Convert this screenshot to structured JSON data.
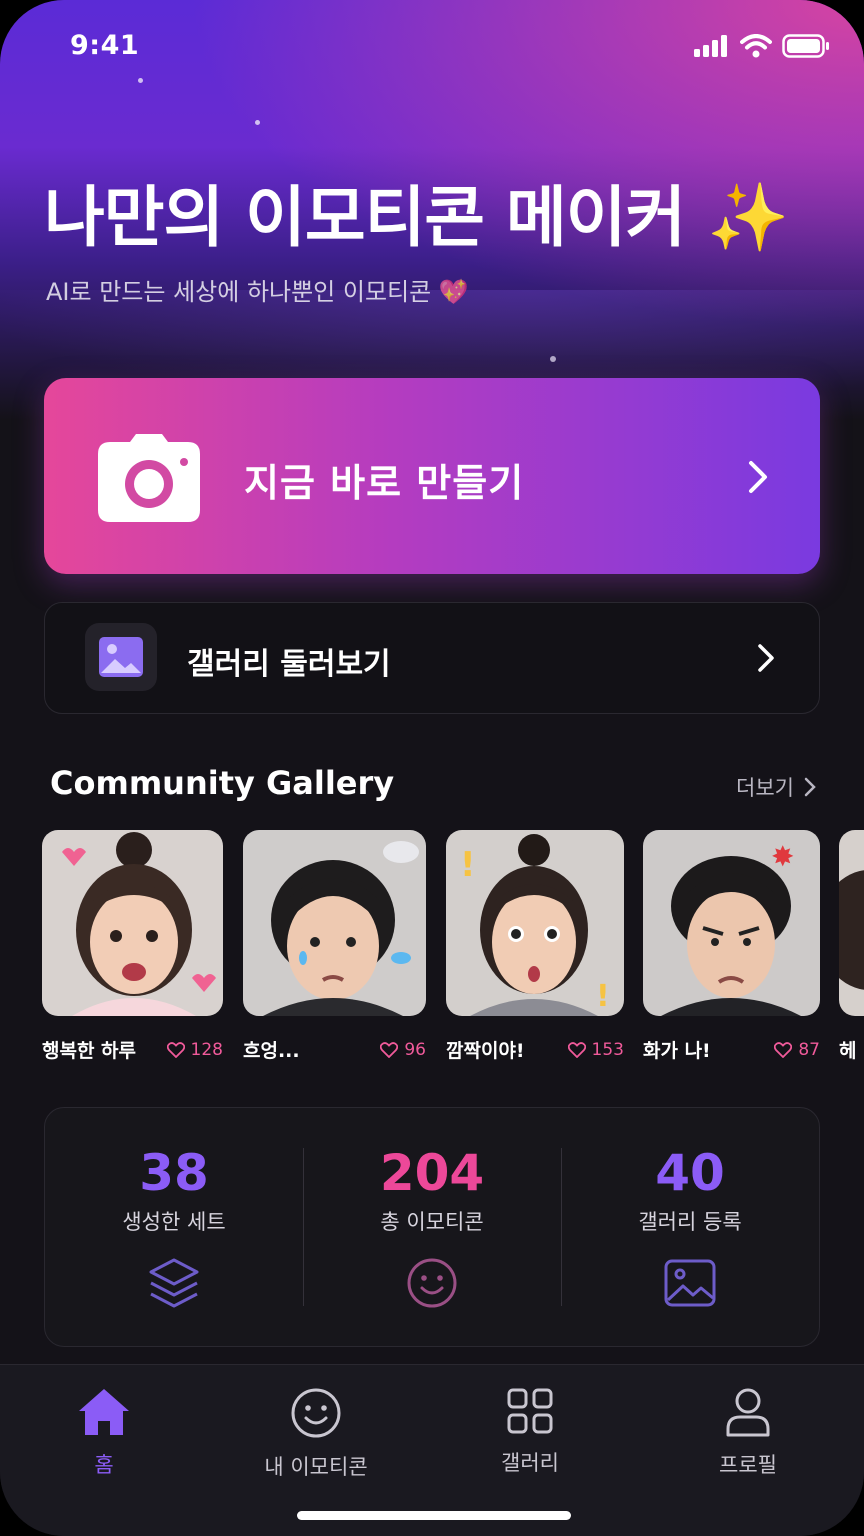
{
  "status": {
    "time": "9:41"
  },
  "hero": {
    "title": "나만의 이모티콘 메이커",
    "title_emoji": "✨",
    "subtitle": "AI로 만드는 세상에 하나뿐인 이모티콘 💖"
  },
  "cta": {
    "label": "지금 바로 만들기",
    "icon": "camera-icon"
  },
  "gallery_button": {
    "label": "갤러리 둘러보기",
    "icon": "image-icon"
  },
  "community": {
    "title": "Community Gallery",
    "more_label": "더보기",
    "items": [
      {
        "name": "행복한 하루",
        "likes": "128"
      },
      {
        "name": "흐엉...",
        "likes": "96"
      },
      {
        "name": "깜짝이야!",
        "likes": "153"
      },
      {
        "name": "화가 나!",
        "likes": "87"
      },
      {
        "name": "헤"
      }
    ]
  },
  "stats": [
    {
      "value": "38",
      "label": "생성한 세트",
      "color": "#8b5cf6",
      "icon": "layers-icon"
    },
    {
      "value": "204",
      "label": "총 이모티콘",
      "color": "#ec4899",
      "icon": "smile-icon"
    },
    {
      "value": "40",
      "label": "갤러리 등록",
      "color": "#8b5cf6",
      "icon": "image-icon"
    }
  ],
  "tabs": [
    {
      "label": "홈",
      "icon": "home-icon",
      "active": true
    },
    {
      "label": "내 이모티콘",
      "icon": "smile-icon"
    },
    {
      "label": "갤러리",
      "icon": "grid-icon"
    },
    {
      "label": "프로필",
      "icon": "user-icon"
    }
  ],
  "colors": {
    "accent": "#8b5cf6",
    "pink": "#ec4899",
    "background": "#141218"
  }
}
